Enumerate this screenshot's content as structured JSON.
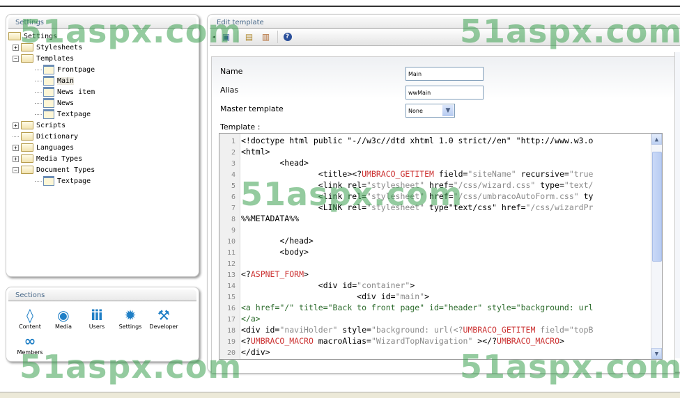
{
  "settings_panel": {
    "title": "Settings",
    "tree": [
      {
        "label": "Settings",
        "level": 0,
        "icon": "open-folder-icon",
        "toggle": ""
      },
      {
        "label": "Stylesheets",
        "level": 1,
        "icon": "folder-icon",
        "toggle": "+"
      },
      {
        "label": "Templates",
        "level": 1,
        "icon": "open-folder-icon",
        "toggle": "-"
      },
      {
        "label": "Frontpage",
        "level": 2,
        "icon": "template-icon",
        "toggle": ""
      },
      {
        "label": "Main",
        "level": 2,
        "icon": "template-icon",
        "toggle": "",
        "selected": true
      },
      {
        "label": "News item",
        "level": 2,
        "icon": "template-icon",
        "toggle": ""
      },
      {
        "label": "News",
        "level": 2,
        "icon": "template-icon",
        "toggle": ""
      },
      {
        "label": "Textpage",
        "level": 2,
        "icon": "template-icon",
        "toggle": ""
      },
      {
        "label": "Scripts",
        "level": 1,
        "icon": "folder-icon",
        "toggle": "+"
      },
      {
        "label": "Dictionary",
        "level": 1,
        "icon": "folder-icon",
        "toggle": ""
      },
      {
        "label": "Languages",
        "level": 1,
        "icon": "folder-icon",
        "toggle": "+"
      },
      {
        "label": "Media Types",
        "level": 1,
        "icon": "folder-icon",
        "toggle": "+"
      },
      {
        "label": "Document Types",
        "level": 1,
        "icon": "open-folder-icon",
        "toggle": "-"
      },
      {
        "label": "Textpage",
        "level": 2,
        "icon": "document-type-icon",
        "toggle": ""
      }
    ]
  },
  "sections_panel": {
    "title": "Sections",
    "items": [
      {
        "label": "Content",
        "icon": "content-icon",
        "glyph": "◊"
      },
      {
        "label": "Media",
        "icon": "media-icon",
        "glyph": "◉"
      },
      {
        "label": "Users",
        "icon": "users-icon",
        "glyph": "ⅲ"
      },
      {
        "label": "Settings",
        "icon": "settings-icon",
        "glyph": "✹"
      },
      {
        "label": "Developer",
        "icon": "developer-icon",
        "glyph": "⚒"
      },
      {
        "label": "Members",
        "icon": "members-icon",
        "glyph": "∞"
      }
    ]
  },
  "editor": {
    "title": "Edit template",
    "toolbar": [
      "save-icon",
      "insert-field-icon",
      "insert-macro-icon",
      "help-icon"
    ],
    "name_label": "Name",
    "name_value": "Main",
    "alias_label": "Alias",
    "alias_value": "wwMain",
    "master_label": "Master template",
    "master_value": "None",
    "template_label": "Template :",
    "code_lines": [
      [
        [
          "<!doctype html public \"-//w3c//dtd xhtml 1.0 strict//en\" \"http://www.w3.o",
          ""
        ]
      ],
      [
        [
          "<html>",
          ""
        ]
      ],
      [
        [
          "        <head>",
          ""
        ]
      ],
      [
        [
          "                <title><?",
          ""
        ],
        [
          "UMBRACO_GETITEM",
          "r"
        ],
        [
          " field=",
          ""
        ],
        [
          "\"siteName\"",
          "s"
        ],
        [
          " recursive=",
          ""
        ],
        [
          "\"true",
          "s"
        ]
      ],
      [
        [
          "                <link rel=",
          ""
        ],
        [
          "\"stylesheet\"",
          "s"
        ],
        [
          " href=",
          ""
        ],
        [
          "\"/css/wizard.css\"",
          "s"
        ],
        [
          " type=",
          ""
        ],
        [
          "\"text/",
          "s"
        ]
      ],
      [
        [
          "                <link rel=",
          ""
        ],
        [
          "\"stylesheet\"",
          "s"
        ],
        [
          " href=",
          ""
        ],
        [
          "\"/css/umbracoAutoForm.css\"",
          "s"
        ],
        [
          " ty",
          ""
        ]
      ],
      [
        [
          "                <LINK rel=",
          ""
        ],
        [
          "\"stylesheet\"",
          "s"
        ],
        [
          " type\"text/css\" href=",
          ""
        ],
        [
          "\"/css/wizardPr",
          "s"
        ]
      ],
      [
        [
          "%%METADATA%%",
          ""
        ]
      ],
      [
        [
          "",
          ""
        ]
      ],
      [
        [
          "        </head>",
          ""
        ]
      ],
      [
        [
          "        <body>",
          ""
        ]
      ],
      [
        [
          "",
          ""
        ]
      ],
      [
        [
          "<?",
          ""
        ],
        [
          "ASPNET_FORM",
          "r"
        ],
        [
          ">",
          ""
        ]
      ],
      [
        [
          "                <div id=",
          ""
        ],
        [
          "\"container\"",
          "s"
        ],
        [
          ">",
          ""
        ]
      ],
      [
        [
          "                        <div id=",
          ""
        ],
        [
          "\"main\"",
          "s"
        ],
        [
          ">",
          ""
        ]
      ],
      [
        [
          "<a href=\"/\" title=\"Back to front page\" id=\"header\" style=\"background: url",
          "g"
        ]
      ],
      [
        [
          "</a>",
          "g"
        ]
      ],
      [
        [
          "<div id=",
          ""
        ],
        [
          "\"naviHolder\"",
          "s"
        ],
        [
          " style=",
          ""
        ],
        [
          "\"background: url(<?",
          "s"
        ],
        [
          "UMBRACO_GETITEM",
          "r"
        ],
        [
          " field=\"topB",
          "s"
        ]
      ],
      [
        [
          "<?",
          ""
        ],
        [
          "UMBRACO_MACRO",
          "r"
        ],
        [
          " macroAlias=",
          ""
        ],
        [
          "\"WizardTopNavigation\"",
          "s"
        ],
        [
          " ></?",
          ""
        ],
        [
          "UMBRACO_MACRO",
          "r"
        ],
        [
          ">",
          ""
        ]
      ],
      [
        [
          "</div>",
          ""
        ]
      ]
    ]
  },
  "watermark": "51aspx.com",
  "colors": {
    "accent": "#1f7fc6",
    "string": "#8a8a8a",
    "keyword": "#cc3333"
  }
}
